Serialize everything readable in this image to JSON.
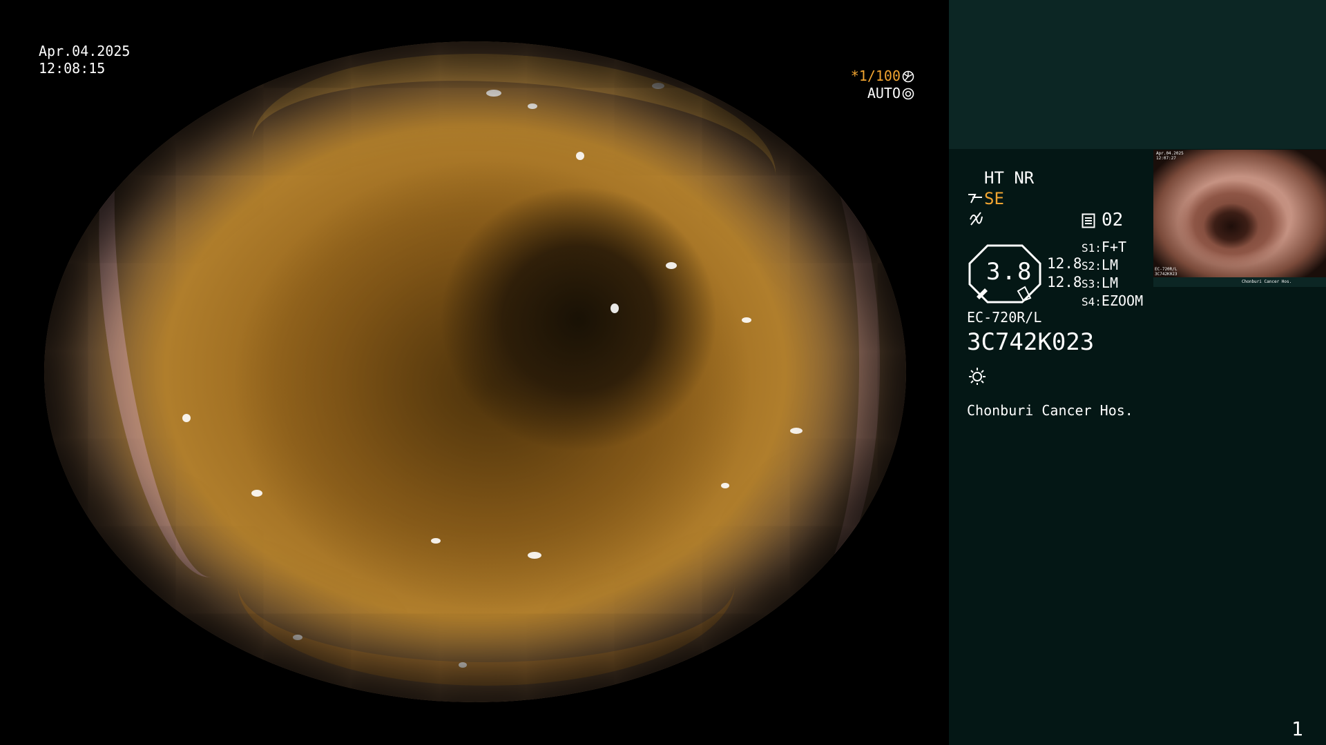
{
  "overlay": {
    "date": "Apr.04.2025",
    "time": "12:08:15",
    "shutter": "*1/100",
    "iris_mode": "AUTO",
    "icons": [
      "shutter-icon",
      "iris-icon"
    ]
  },
  "panel": {
    "mode": "HT NR",
    "enhance": "SE",
    "freeze_icon": "freeze-icon",
    "record_count": "02",
    "gauge_value": "3.8",
    "gauge_sub1": "12.8",
    "gauge_sub2": "12.8",
    "switches": [
      {
        "key": "S1:",
        "value": "F+T"
      },
      {
        "key": "S2:",
        "value": "LM"
      },
      {
        "key": "S3:",
        "value": "LM"
      },
      {
        "key": "S4:",
        "value": "EZOOM"
      }
    ],
    "scope_model": "EC-720R/L",
    "serial": "3C742K023",
    "light_icon": "brightness-icon",
    "hospital": "Chonburi Cancer Hos.",
    "page_number": "1",
    "accent_color": "#f2a531"
  },
  "thumbnail": {
    "date": "Apr.04.2025",
    "time": "12:07:27",
    "model": "EC-720R/L",
    "serial": "3C742K023",
    "hospital": "Chonburi Cancer Hos."
  }
}
